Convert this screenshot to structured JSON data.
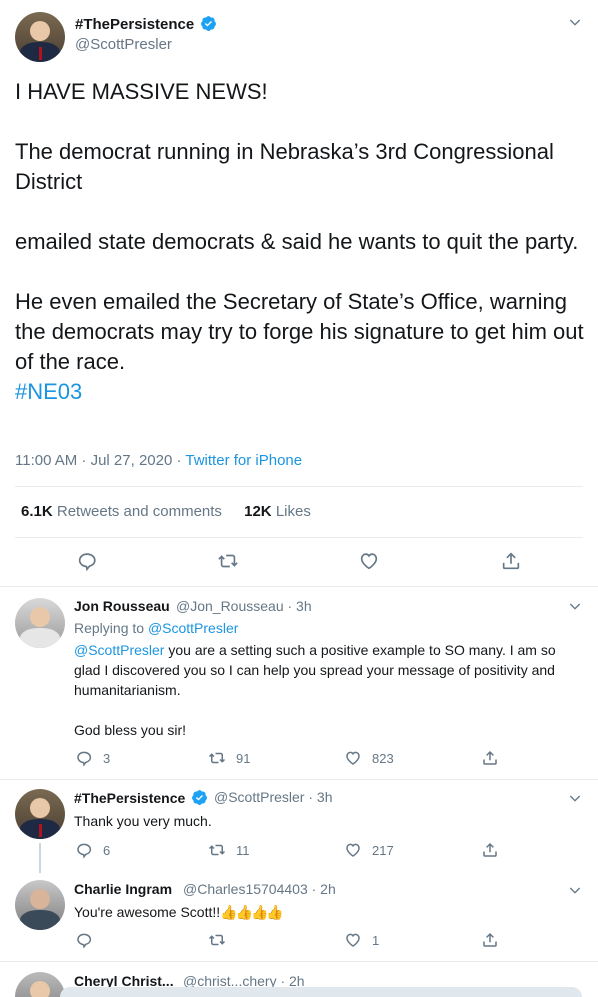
{
  "main_tweet": {
    "display_name": "#ThePersistence",
    "handle": "@ScottPresler",
    "paragraphs": [
      "I HAVE MASSIVE NEWS!",
      "The democrat running in Nebraska’s 3rd Congressional District",
      "emailed state democrats & said he wants to quit the party.",
      "He even emailed the Secretary of State’s Office, warning the democrats may try to forge his signature to get him out of the race."
    ],
    "hashtag": "#NE03",
    "timestamp": "11:00 AM · Jul 27, 2020 · ",
    "source": "Twitter for iPhone",
    "retweets_count": "6.1K",
    "retweets_label": "Retweets and comments",
    "likes_count": "12K",
    "likes_label": "Likes"
  },
  "replies": [
    {
      "display_name": "Jon Rousseau",
      "handle_time": "@Jon_Rousseau · 3h",
      "replying_label": "Replying to ",
      "replying_to": "@ScottPresler",
      "mention": "@ScottPresler",
      "text": " you are a setting such a positive example to SO many. I am so glad I discovered you so I can help you spread your message of positivity and humanitarianism.",
      "text2": "God bless you sir!",
      "reply_count": "3",
      "retweet_count": "91",
      "like_count": "823"
    },
    {
      "display_name": "#ThePersistence",
      "handle_time": "@ScottPresler · 3h",
      "text": "Thank you very much.",
      "reply_count": "6",
      "retweet_count": "11",
      "like_count": "217"
    },
    {
      "display_name": "Charlie Ingram",
      "handle_time": "@Charles15704403 · 2h",
      "text": "You're awesome Scott!!",
      "emoji": "👍👍👍👍",
      "reply_count": "",
      "retweet_count": "",
      "like_count": "1"
    },
    {
      "display_name": "Cheryl Christ...",
      "handle_time": "@christ...chery · 2h"
    }
  ],
  "colors": {
    "accent": "#1b95e0",
    "verified": "#1da1f2",
    "muted": "#657786",
    "text": "#14171a",
    "border": "#e6ecf0"
  },
  "icons": [
    "verified-icon",
    "chevron-down-icon",
    "reply-icon",
    "retweet-icon",
    "like-icon",
    "share-icon"
  ]
}
